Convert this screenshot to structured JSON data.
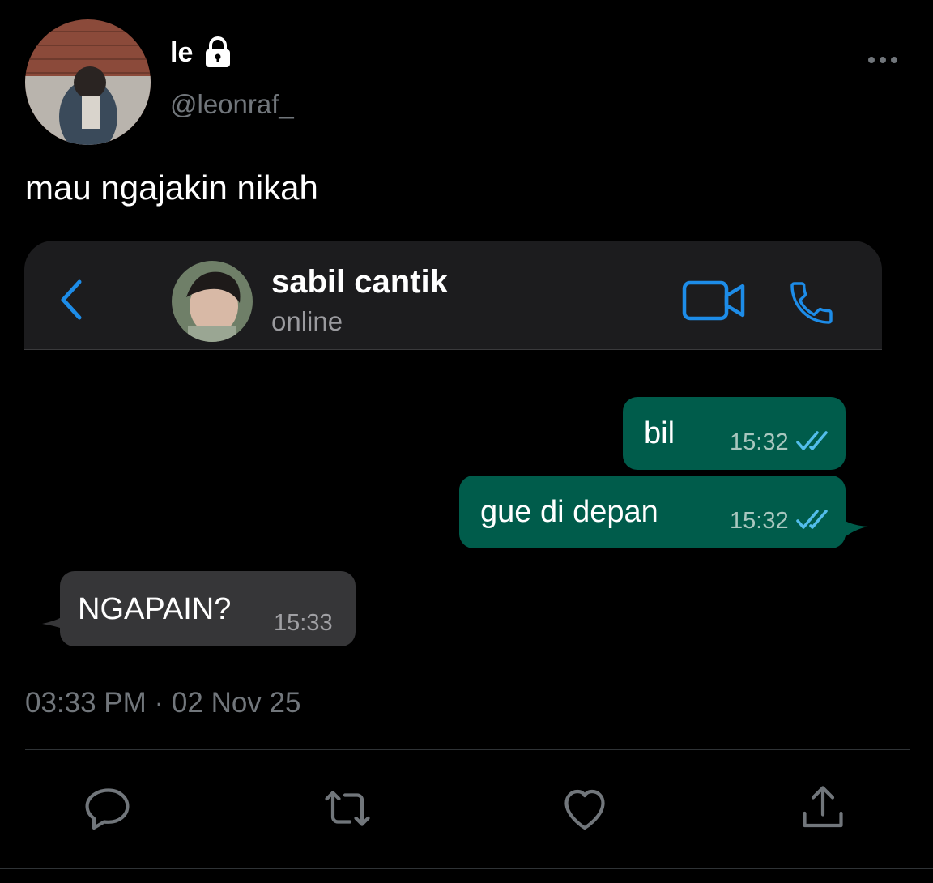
{
  "tweet": {
    "display_name": "le",
    "handle": "@leonraf_",
    "text": "mau ngajakin nikah",
    "timestamp": "03:33 PM · 02 Nov 25"
  },
  "chat": {
    "contact_name": "sabil cantik",
    "status": "online",
    "accent_color": "#1d8ce8",
    "messages": [
      {
        "direction": "outgoing",
        "text": "bil",
        "time": "15:32",
        "read": true
      },
      {
        "direction": "outgoing",
        "text": "gue di depan",
        "time": "15:32",
        "read": true
      },
      {
        "direction": "incoming",
        "text": "NGAPAIN?",
        "time": "15:33"
      }
    ]
  },
  "icons": {
    "lock": "lock-icon",
    "more": "more-icon",
    "back": "chevron-left-icon",
    "video": "video-call-icon",
    "phone": "phone-icon",
    "reply": "reply-icon",
    "retweet": "retweet-icon",
    "like": "heart-icon",
    "share": "share-icon"
  }
}
